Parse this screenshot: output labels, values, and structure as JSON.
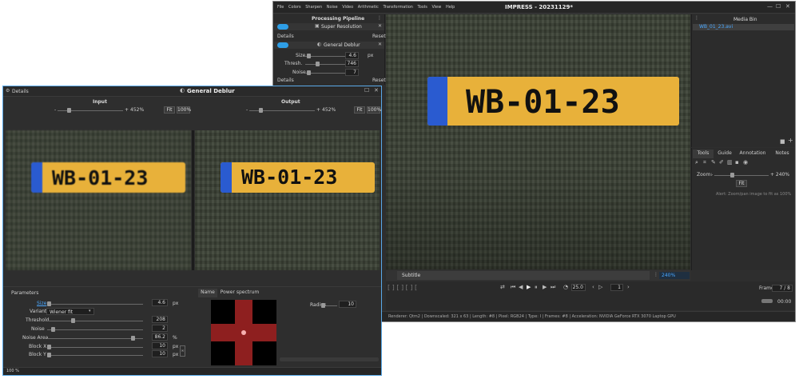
{
  "main": {
    "menu": [
      "File",
      "Colors",
      "Sharpen",
      "Noise",
      "Video",
      "Arithmetic",
      "Transformation",
      "Tools",
      "View",
      "Help"
    ],
    "title": "IMPRESS - 20231129*",
    "pipeline": {
      "header": "Processing Pipeline",
      "item1": "Super Resolution",
      "details1": "Details",
      "reset1": "Reset",
      "item2": "General Deblur",
      "params": [
        {
          "label": "Size",
          "value": "4.6",
          "unit": "px"
        },
        {
          "label": "Thresh.",
          "value": "746",
          "unit": ""
        },
        {
          "label": "Noise",
          "value": "7",
          "unit": ""
        }
      ],
      "details2": "Details",
      "reset2": "Reset"
    },
    "media_bin": {
      "header": "Media Bin",
      "file": "WB_01_23.avi"
    },
    "viewer_tab": "Subtitle",
    "zoom_badge": "240%",
    "tools_tabs": [
      "Tools",
      "Guide",
      "Annotation",
      "Notes"
    ],
    "zoom_label": "Zoom:",
    "zoom_value": "+ 240%",
    "fit": "Fit",
    "hint": "Alert: Zoom/pan image to fit as 100%",
    "frame_display": "25.0",
    "frame_box": "1",
    "frames_label": "Frame:",
    "frames_value": "7 / 8",
    "time": "00:00",
    "status": "Renderer: Qtm2 | Downscaled: 321 x 63 | Length: #8 | Pixel: RGB24 | Type: I | Frames: #8 | Acceleration: NVIDIA GeForce RTX 3070 Laptop GPU"
  },
  "dialog": {
    "details": "Details",
    "title": "General Deblur",
    "input_label": "Input",
    "output_label": "Output",
    "input_zoom": "452%",
    "output_zoom": "452%",
    "fit": "Fit",
    "p100": "100%",
    "plate_text": "WB-01-23",
    "params_label": "Parameters",
    "size": {
      "label": "Size",
      "value": "4.6",
      "unit": "px"
    },
    "variant": {
      "label": "Variant",
      "value": "Wiener fit"
    },
    "threshold": {
      "label": "Threshold",
      "value": "208"
    },
    "noise": {
      "label": "Noise",
      "value": "2"
    },
    "noise_area": {
      "label": "Noise Area",
      "value": "86.2",
      "unit": "%"
    },
    "block_x": {
      "label": "Block X",
      "value": "10",
      "unit": "px"
    },
    "block_y": {
      "label": "Block Y",
      "value": "10",
      "unit": "px"
    },
    "tabs": [
      "Name",
      "Power spectrum"
    ],
    "radius": {
      "label": "Radius",
      "value": "10"
    },
    "footer": "100 %"
  },
  "colors": {
    "accent": "#2e9ee6",
    "window": "#2e2e2e",
    "plate": "#e8b13a"
  }
}
